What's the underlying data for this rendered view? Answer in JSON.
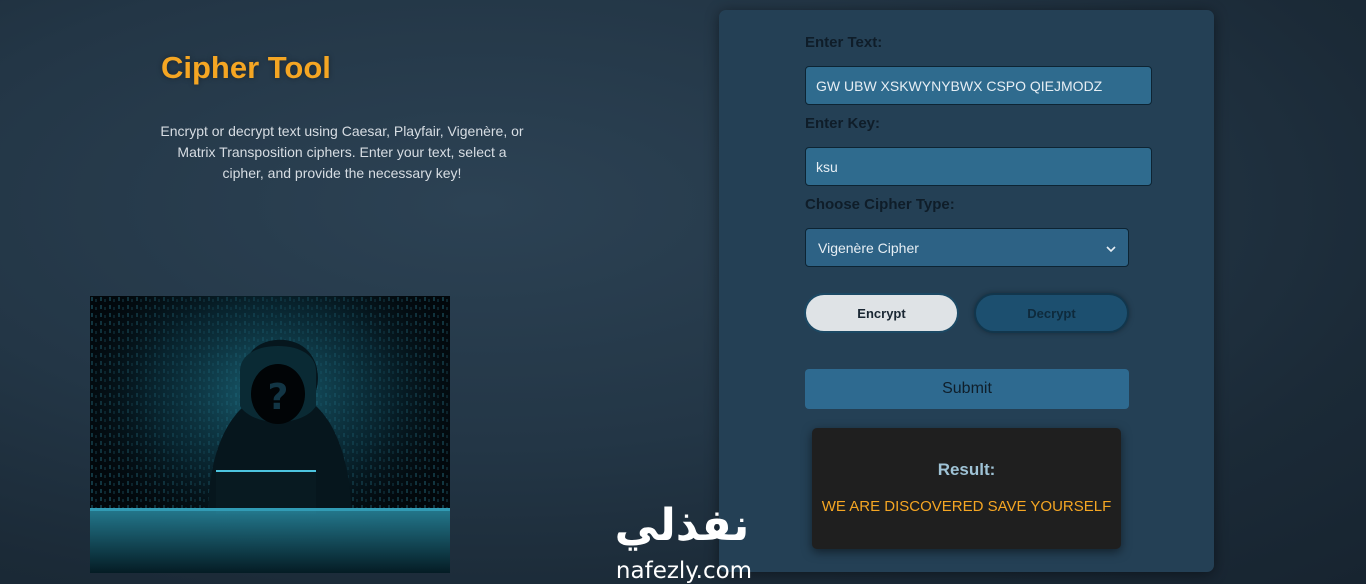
{
  "page": {
    "title": "Cipher Tool",
    "description": "Encrypt or decrypt text using Caesar, Playfair, Vigenère, or Matrix Transposition ciphers. Enter your text, select a cipher, and provide the necessary key!"
  },
  "form": {
    "text_label": "Enter Text:",
    "text_value": "GW UBW XSKWYNYBWX CSPO QIEJMODZ",
    "key_label": "Enter Key:",
    "key_value": "ksu",
    "cipher_label": "Choose Cipher Type:",
    "cipher_selected": "Vigenère Cipher",
    "encrypt_label": "Encrypt",
    "decrypt_label": "Decrypt",
    "submit_label": "Submit"
  },
  "result": {
    "label": "Result:",
    "value": "WE ARE DISCOVERED SAVE YOURSELF"
  },
  "watermark": {
    "arabic": "نفذلي",
    "latin": "nafezly.com"
  },
  "colors": {
    "accent": "#f5a623",
    "card_bg": "#244055",
    "input_bg": "#2f6b8e",
    "result_bg": "#1f1f1f"
  }
}
